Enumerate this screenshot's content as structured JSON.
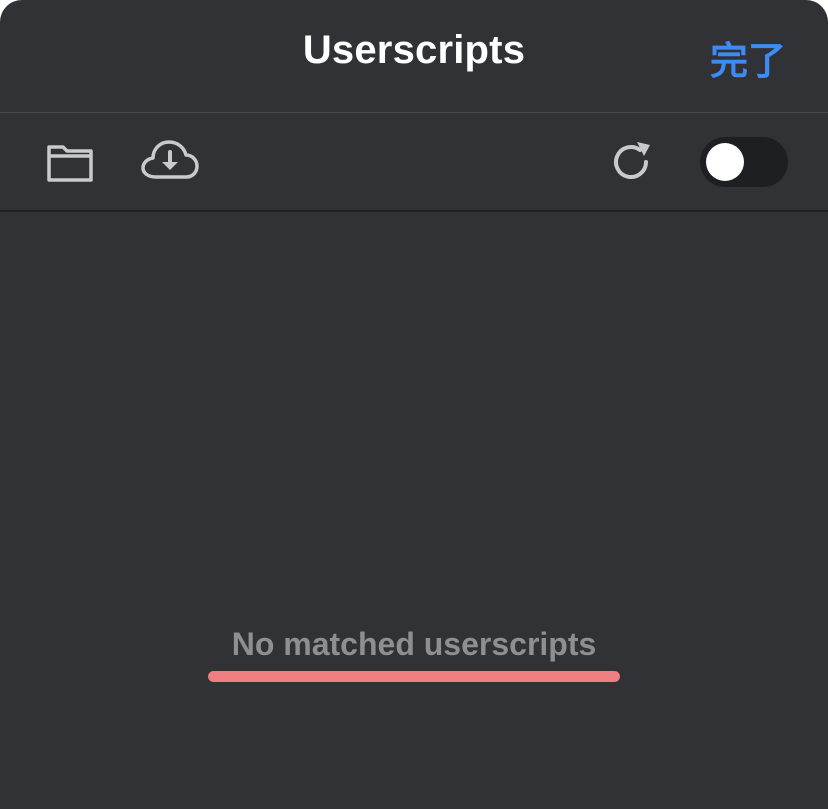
{
  "header": {
    "title": "Userscripts",
    "done_label": "完了"
  },
  "toolbar": {
    "items": [
      {
        "icon": "folder-icon"
      },
      {
        "icon": "cloud-download-icon"
      },
      {
        "icon": "refresh-icon"
      }
    ],
    "toggle": {
      "state": "off"
    }
  },
  "main": {
    "empty_message": "No matched userscripts"
  },
  "colors": {
    "background": "#303236",
    "accent": "#3d8cf5",
    "annotation": "#f07d80",
    "muted_text": "#8e8f93"
  }
}
